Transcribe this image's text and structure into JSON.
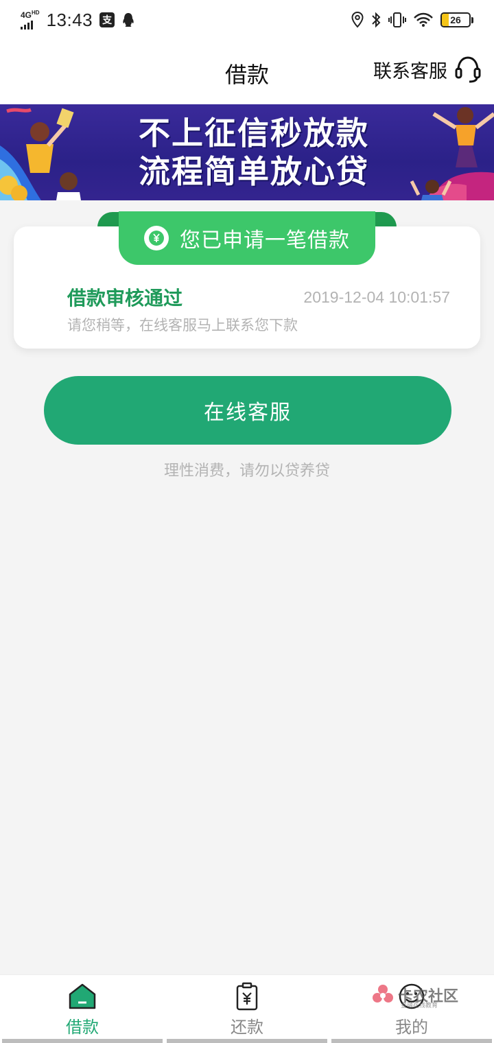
{
  "status_bar": {
    "network": "4G",
    "network_hd": "HD",
    "time": "13:43",
    "battery": "26",
    "battery_level_percent": 26
  },
  "header": {
    "title": "借款",
    "support_label": "联系客服"
  },
  "banner": {
    "line1": "不上征信秒放款",
    "line2": "流程简单放心贷"
  },
  "loan_card": {
    "badge_text": "您已申请一笔借款",
    "status_title": "借款审核通过",
    "status_time": "2019-12-04 10:01:57",
    "status_desc": "请您稍等，在线客服马上联系您下款"
  },
  "actions": {
    "service_button": "在线客服",
    "tip": "理性消费，请勿以贷养贷"
  },
  "tabs": [
    {
      "label": "借款",
      "icon": "home-icon",
      "active": true
    },
    {
      "label": "还款",
      "icon": "repay-icon",
      "active": false
    },
    {
      "label": "我的",
      "icon": "smiley-icon",
      "active": false
    }
  ],
  "watermark": {
    "text": "卡农社区",
    "sub": "金融在线教育"
  },
  "colors": {
    "accent": "#21a874",
    "badge": "#3dc76a",
    "status_title": "#1f9a5a",
    "banner_bg": "#2b2188"
  }
}
